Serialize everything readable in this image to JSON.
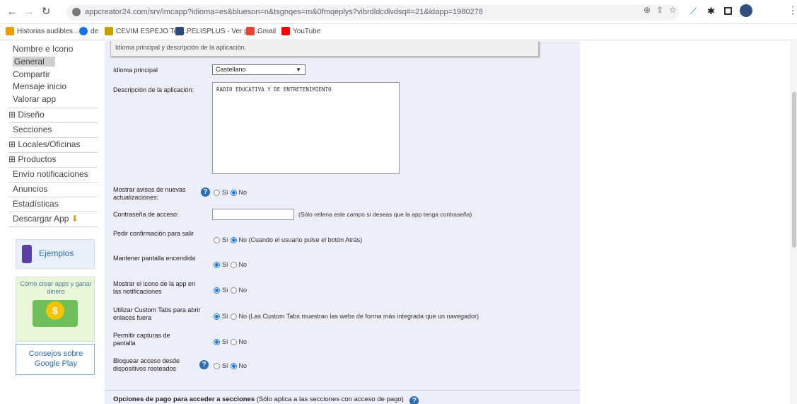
{
  "browser": {
    "url": "appcreator24.com/srv/imcapp?idioma=es&blueson=n&tsgnqes=m&0fmqeplys?vibrdldcdlvdsq#=21&idapp=1980278",
    "bookmarks": [
      {
        "label": "Historias audibles...",
        "icon": "audible-icon",
        "color": "#f29900"
      },
      {
        "label": "de",
        "icon": "chrome-icon",
        "color": "#1a73e8"
      },
      {
        "label": "CEVIM ESPEJO Tod...",
        "icon": "cevim-icon",
        "color": "#c4a000"
      },
      {
        "label": "PELISPLUS - Ver pel...",
        "icon": "pelisplus-icon",
        "color": "#2b4a7a"
      },
      {
        "label": "Gmail",
        "icon": "gmail-icon",
        "color": "#ea4335"
      },
      {
        "label": "YouTube",
        "icon": "youtube-icon",
        "color": "#ff0000"
      }
    ]
  },
  "sidebar": {
    "items": [
      {
        "label": "Nombre e Icono",
        "kind": "sub"
      },
      {
        "label": "General",
        "kind": "sub-active"
      },
      {
        "label": "Compartir",
        "kind": "sub"
      },
      {
        "label": "Mensaje inicio",
        "kind": "sub"
      },
      {
        "label": "Valorar app",
        "kind": "sub"
      },
      {
        "label": "⊞ Diseño",
        "kind": "top"
      },
      {
        "label": "Secciones",
        "kind": "sub"
      },
      {
        "label": "⊞ Locales/Oficinas",
        "kind": "top"
      },
      {
        "label": "⊞ Productos",
        "kind": "top"
      },
      {
        "label": "Envío notificaciones",
        "kind": "sub"
      },
      {
        "label": "Anuncios",
        "kind": "sub"
      },
      {
        "label": "Estadísticas",
        "kind": "sub"
      },
      {
        "label": "Descargar App",
        "kind": "sub"
      }
    ],
    "promo_examples": "Ejemplos",
    "promo_money": "Cómo crear apps y ganar dinero",
    "promo_tips": "Consejos sobre Google Play"
  },
  "panel": {
    "header": "Idioma principal y descripción de la aplicación.",
    "language_label": "Idioma principal",
    "language_value": "Castellano",
    "description_label": "Descripción de la aplicación:",
    "description_value": "RADIO EDUCATIVA Y DE ENTRETENIMIENTO",
    "updates_label": "Mostrar avisos de nuevas actualizaciones:",
    "password_label": "Contraseña de acceso:",
    "password_value": "",
    "password_hint": "(Sólo rellena este campo si deseas que la app tenga contraseña)",
    "exit_label": "Pedir confirmación para salir",
    "exit_no_text": "No (Cuando el usuario pulse el botón Atrás)",
    "screen_label": "Mantener pantalla encendida",
    "icon_label": "Mostrar el icono de la app en las notificaciones",
    "tabs_label": "Utilizar Custom Tabs para abrir enlaces fuera",
    "tabs_no_text": "No (Las Custom Tabs muestran las webs de forma más integrada que un navegador)",
    "capture_label": "Permitir capturas de pantalla",
    "rooted_label": "Bloquear acceso desde dispositivos rooteados",
    "yes": "Sí",
    "no": "No",
    "payment_bold": "Opciones de pago para acceder a secciones",
    "payment_rest": "(Sólo aplica a las secciones con acceso de pago)",
    "help_glyph": "?"
  },
  "radios": {
    "updates": "no",
    "exit": "no",
    "screen": "yes",
    "icon": "yes",
    "tabs": "yes",
    "capture": "yes",
    "rooted": "no"
  }
}
